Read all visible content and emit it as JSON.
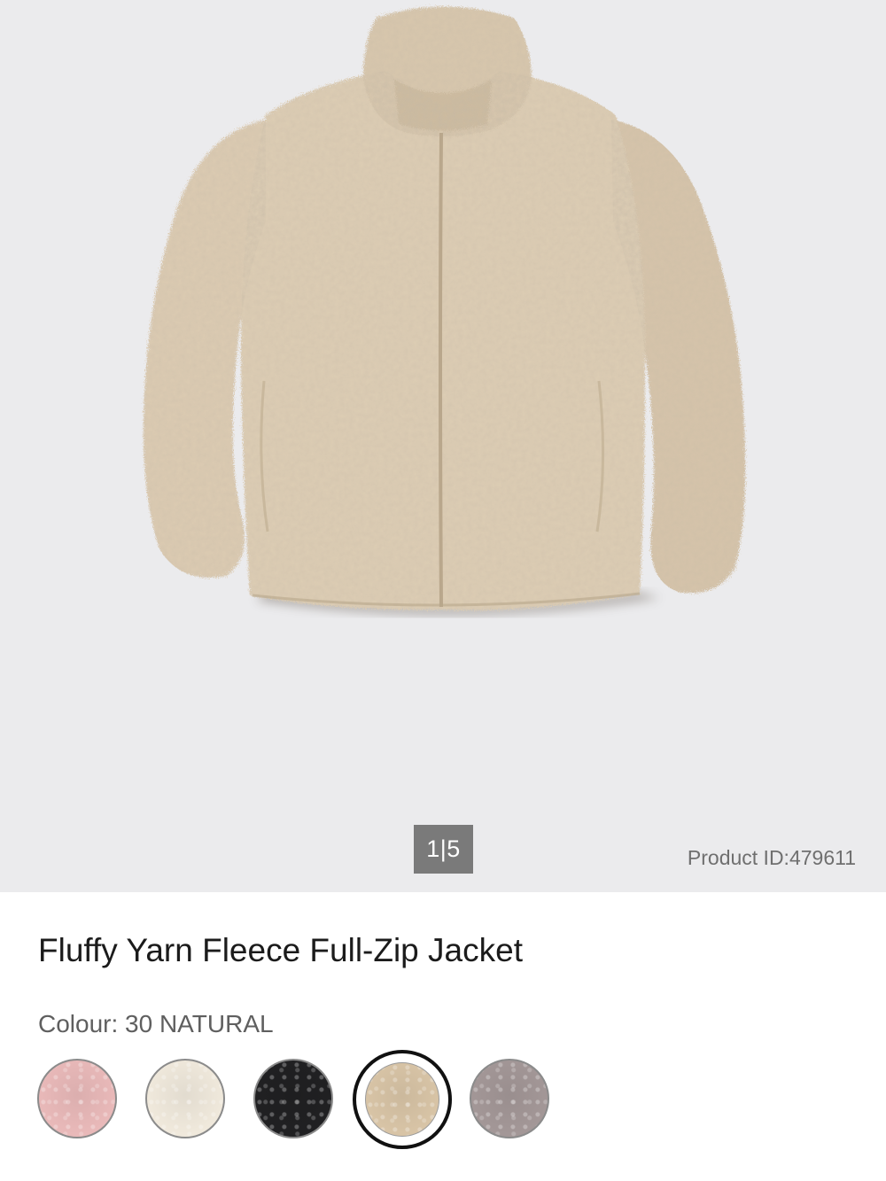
{
  "gallery": {
    "pager": "1|5",
    "product_id": "Product ID:479611",
    "background": "#ebebed",
    "jacket_color": "#dccbb2"
  },
  "product": {
    "title": "Fluffy Yarn Fleece Full-Zip Jacket",
    "colour_label": "Colour: 30 NATURAL"
  },
  "swatches": [
    {
      "name": "pink",
      "color": "#e9b9b9",
      "selected": false
    },
    {
      "name": "off-white",
      "color": "#f0e9dc",
      "selected": false
    },
    {
      "name": "black",
      "color": "#202022",
      "selected": false
    },
    {
      "name": "natural",
      "color": "#d8c4a6",
      "selected": true
    },
    {
      "name": "grey",
      "color": "#a39797",
      "selected": false
    }
  ]
}
